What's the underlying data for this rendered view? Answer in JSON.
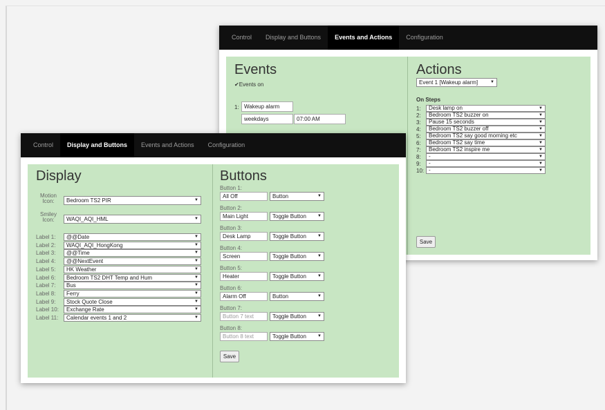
{
  "nav_tabs": [
    "Control",
    "Display and Buttons",
    "Events and Actions",
    "Configuration"
  ],
  "back_window": {
    "events": {
      "title": "Events",
      "events_on_label": "Events on",
      "event_number": "1:",
      "event_name": "Wakeup alarm",
      "event_days": "weekdays",
      "event_time": "07:00 AM"
    },
    "actions": {
      "title": "Actions",
      "event_select": "Event 1 [Wakeup alarm]",
      "on_steps_label": "On Steps",
      "steps": [
        {
          "num": "1:",
          "value": "Desk lamp on"
        },
        {
          "num": "2:",
          "value": "Bedroom TS2 buzzer on"
        },
        {
          "num": "3:",
          "value": "Pause 15 seconds"
        },
        {
          "num": "4:",
          "value": "Bedroom TS2 buzzer off"
        },
        {
          "num": "5:",
          "value": "Bedroom TS2 say good morning etc"
        },
        {
          "num": "6:",
          "value": "Bedroom TS2 say time"
        },
        {
          "num": "7:",
          "value": "Bedroom TS2 inspire me"
        },
        {
          "num": "8:",
          "value": "-"
        },
        {
          "num": "9:",
          "value": "-"
        },
        {
          "num": "10:",
          "value": "-"
        }
      ],
      "save_label": "Save"
    }
  },
  "front_window": {
    "display": {
      "title": "Display",
      "motion_label": "Motion Icon:",
      "motion_value": "Bedroom TS2 PIR",
      "smiley_label": "Smiley Icon:",
      "smiley_value": "WAQI_AQI_HML",
      "labels": [
        {
          "label": "Label 1:",
          "value": "@@Date"
        },
        {
          "label": "Label 2:",
          "value": "WAQI_AQI_HongKong"
        },
        {
          "label": "Label 3:",
          "value": "@@Time"
        },
        {
          "label": "Label 4:",
          "value": "@@NextEvent"
        },
        {
          "label": "Label 5:",
          "value": "HK Weather"
        },
        {
          "label": "Label 6:",
          "value": "Bedroom TS2 DHT Temp and Hum"
        },
        {
          "label": "Label 7:",
          "value": "Bus"
        },
        {
          "label": "Label 8:",
          "value": "Ferry"
        },
        {
          "label": "Label 9:",
          "value": "Stock Quote Close"
        },
        {
          "label": "Label 10:",
          "value": "Exchange Rate"
        },
        {
          "label": "Label 11:",
          "value": "Calendar events 1 and 2"
        }
      ]
    },
    "buttons": {
      "title": "Buttons",
      "items": [
        {
          "label": "Button 1:",
          "text": "All Off",
          "placeholder": "",
          "type": "Button"
        },
        {
          "label": "Button 2:",
          "text": "Main Light",
          "placeholder": "",
          "type": "Toggle Button"
        },
        {
          "label": "Button 3:",
          "text": "Desk Lamp",
          "placeholder": "",
          "type": "Toggle Button"
        },
        {
          "label": "Button 4:",
          "text": "Screen",
          "placeholder": "",
          "type": "Toggle Button"
        },
        {
          "label": "Button 5:",
          "text": "Heater",
          "placeholder": "",
          "type": "Toggle Button"
        },
        {
          "label": "Button 6:",
          "text": "Alarm Off",
          "placeholder": "",
          "type": "Button"
        },
        {
          "label": "Button 7:",
          "text": "",
          "placeholder": "Button 7 text",
          "type": "Toggle Button"
        },
        {
          "label": "Button 8:",
          "text": "",
          "placeholder": "Button 8 text",
          "type": "Toggle Button"
        }
      ],
      "save_label": "Save"
    }
  }
}
